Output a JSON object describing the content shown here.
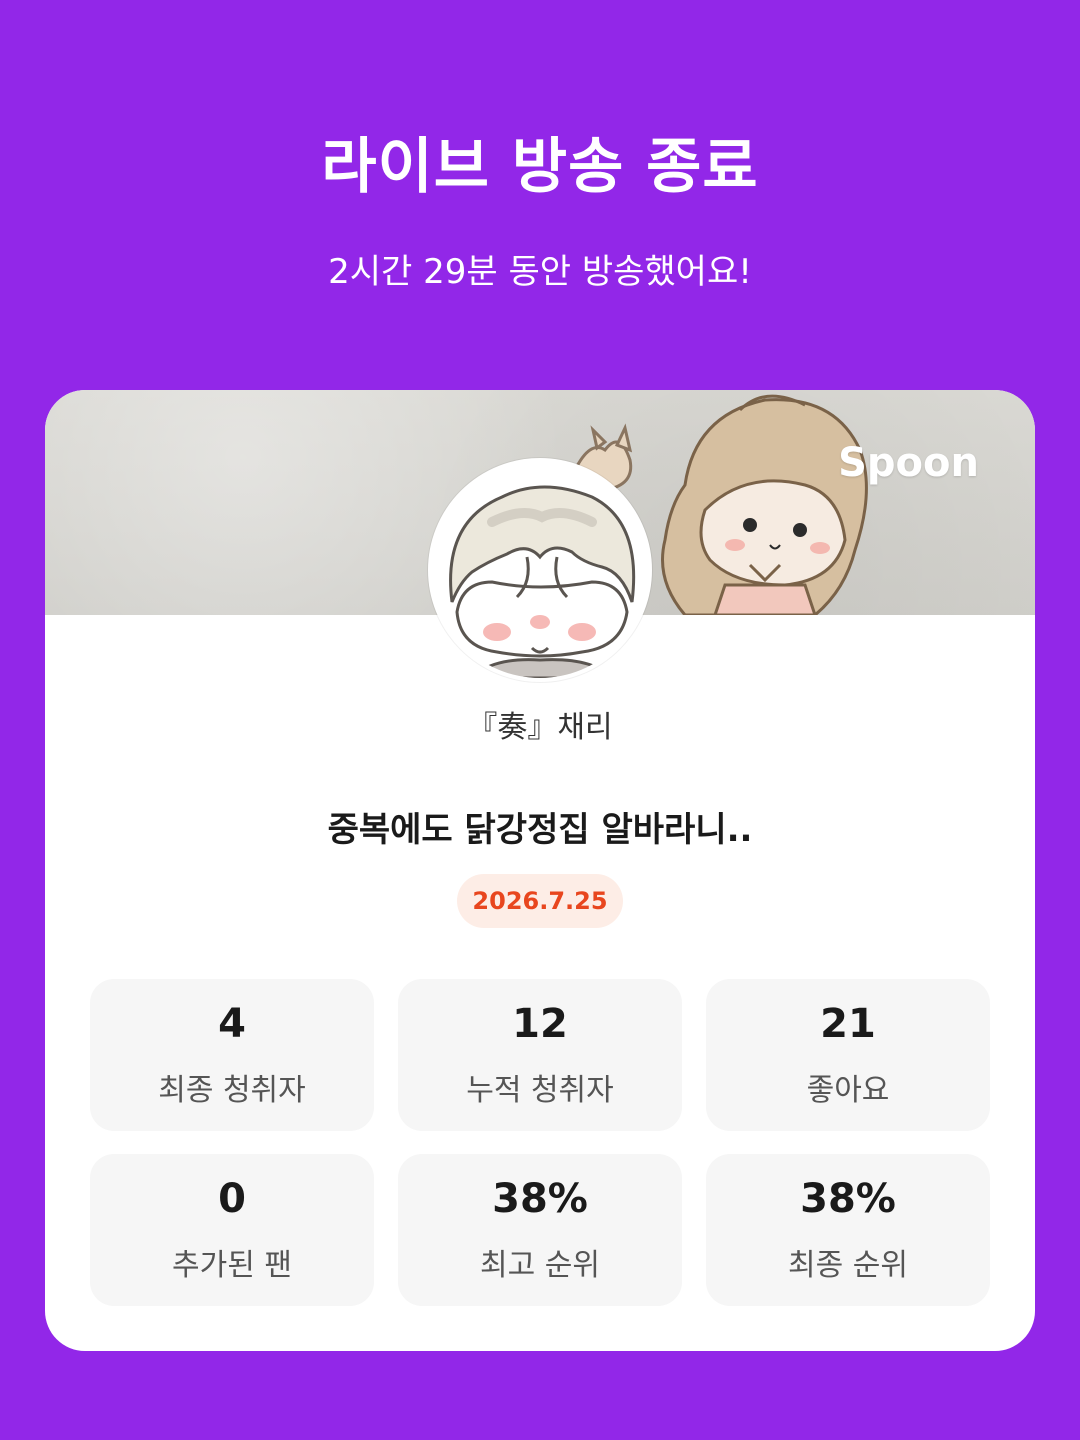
{
  "header": {
    "title": "라이브 방송 종료",
    "subtitle": "2시간 29분 동안 방송했어요!"
  },
  "card": {
    "brand": "Spoon",
    "nickname": "『奏』채리",
    "live_title": "중복에도 닭강정집 알바라니..",
    "date": "2026.7.25",
    "stats": [
      {
        "value": "4",
        "label": "최종 청취자"
      },
      {
        "value": "12",
        "label": "누적 청취자"
      },
      {
        "value": "21",
        "label": "좋아요"
      },
      {
        "value": "0",
        "label": "추가된 팬"
      },
      {
        "value": "38%",
        "label": "최고 순위"
      },
      {
        "value": "38%",
        "label": "최종 순위"
      }
    ]
  },
  "colors": {
    "background": "#9227E8",
    "date_badge_bg": "#FDEDE6",
    "date_badge_text": "#E8461E",
    "stat_box_bg": "#F6F6F6"
  }
}
